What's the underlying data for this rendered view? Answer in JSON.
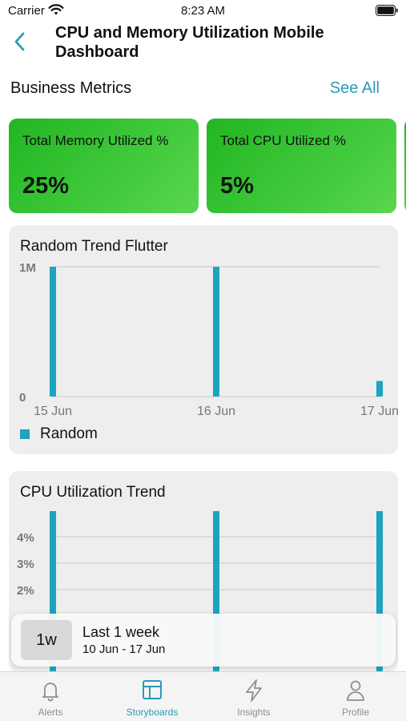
{
  "status_bar": {
    "carrier": "Carrier",
    "time": "8:23 AM"
  },
  "header": {
    "title": "CPU and Memory Utilization Mobile Dashboard"
  },
  "section": {
    "title": "Business Metrics",
    "see_all": "See All"
  },
  "metrics": [
    {
      "label": "Total Memory Utilized %",
      "value": "25%"
    },
    {
      "label": "Total CPU Utilized %",
      "value": "5%"
    }
  ],
  "colors": {
    "accent": "#2a9bb7",
    "bar": "#1ea3c1",
    "card_green": "#3ec83a"
  },
  "chart_data": [
    {
      "type": "bar",
      "title": "Random Trend Flutter",
      "categories": [
        "15 Jun",
        "16 Jun",
        "17 Jun"
      ],
      "y_tick_labels": [
        "1M",
        "0"
      ],
      "ylim": [
        0,
        1000000
      ],
      "series": [
        {
          "name": "Random",
          "values": [
            1000000,
            1000000,
            120000
          ]
        }
      ],
      "legend": "bottom-left",
      "grid": true
    },
    {
      "type": "bar",
      "title": "CPU Utilization Trend",
      "y_tick_labels": [
        "4%",
        "3%",
        "2%"
      ],
      "series": [
        {
          "values": [
            5,
            5,
            5
          ]
        }
      ],
      "grid": true
    }
  ],
  "date_range": {
    "badge": "1w",
    "title": "Last 1 week",
    "dates": "10 Jun - 17 Jun"
  },
  "tabs": [
    {
      "label": "Alerts",
      "icon": "bell-icon",
      "active": false
    },
    {
      "label": "Storyboards",
      "icon": "storyboard-icon",
      "active": true
    },
    {
      "label": "Insights",
      "icon": "lightning-icon",
      "active": false
    },
    {
      "label": "Profile",
      "icon": "person-icon",
      "active": false
    }
  ]
}
